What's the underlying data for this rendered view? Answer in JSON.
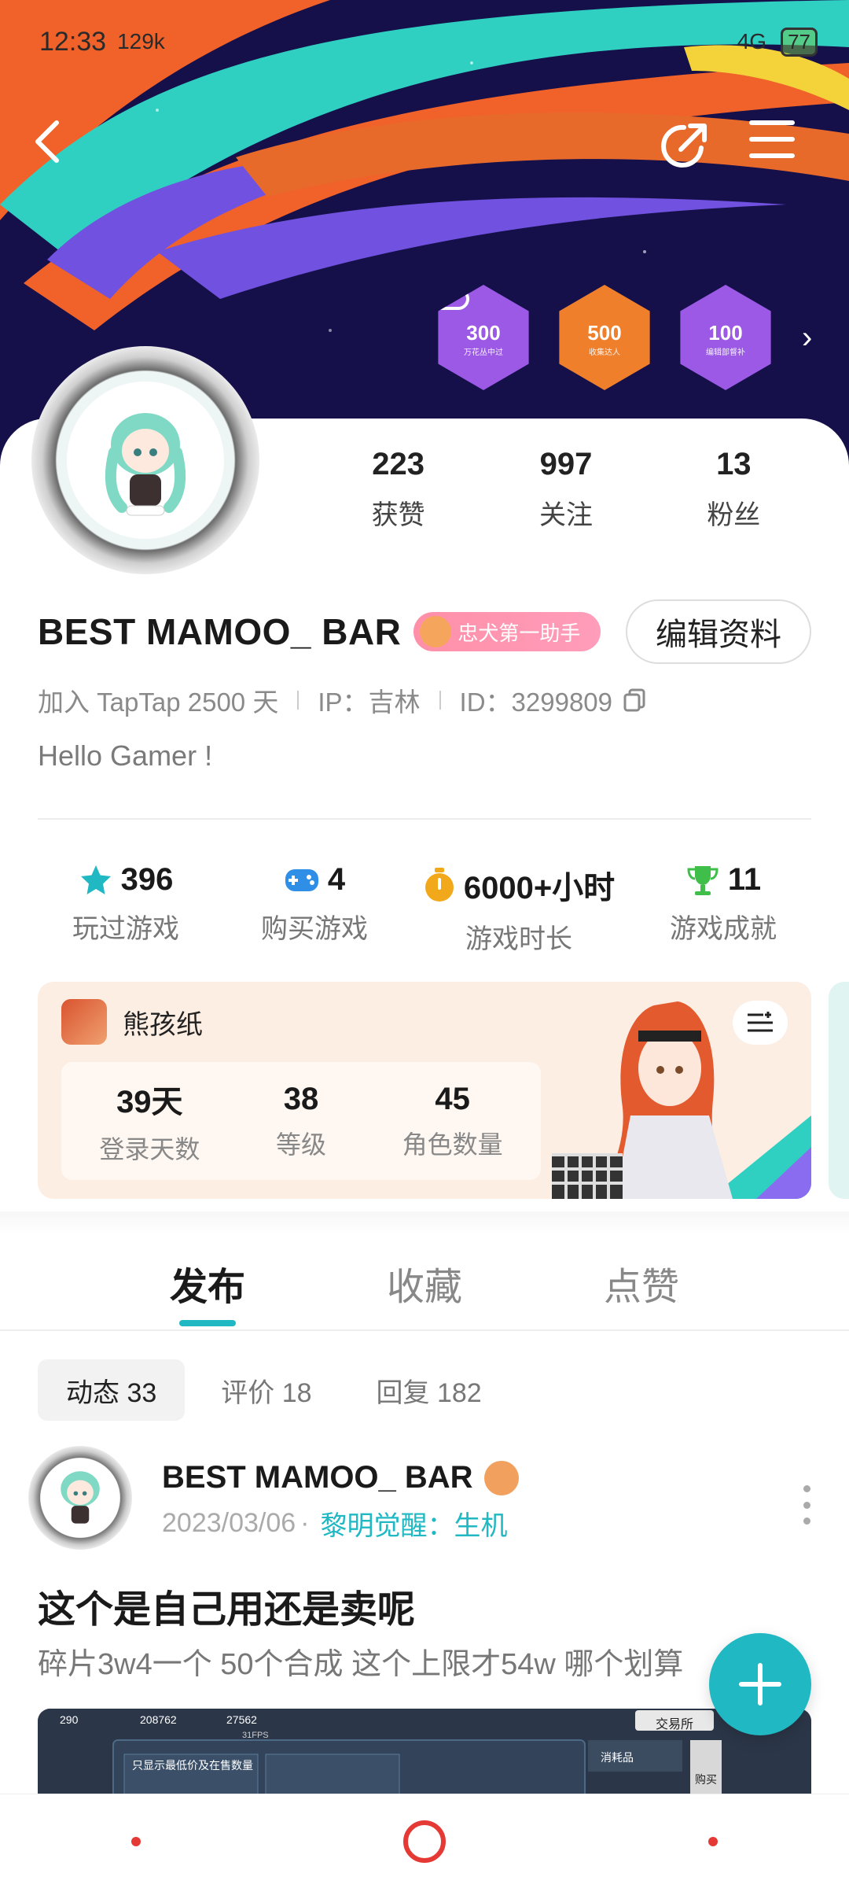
{
  "status_bar": {
    "time": "12:33",
    "speed": "129k",
    "network": "4G",
    "battery": "77"
  },
  "header": {
    "back_icon": "chevron-left-icon",
    "share_icon": "share-icon",
    "menu_icon": "hamburger-menu-icon",
    "badges": [
      {
        "value": "300",
        "caption": "万花丛中过",
        "color": "#9b59e6"
      },
      {
        "value": "500",
        "caption": "收集达人",
        "color": "#f07f2c"
      },
      {
        "value": "100",
        "caption": "编辑部督补",
        "color": "#9b59e6"
      }
    ]
  },
  "profile": {
    "stats": [
      {
        "value": "223",
        "label": "获赞"
      },
      {
        "value": "997",
        "label": "关注"
      },
      {
        "value": "13",
        "label": "粉丝"
      }
    ],
    "name": "BEST MAMOO_ BAR",
    "tag": "忠犬第一助手",
    "edit_label": "编辑资料",
    "joined": "加入 TapTap 2500 天",
    "ip": "IP：吉林",
    "id": "ID：3299809",
    "bio": "Hello Gamer !"
  },
  "game_stats": [
    {
      "value": "396",
      "label": "玩过游戏",
      "icon": "star-icon",
      "color": "#1fb8c3"
    },
    {
      "value": "4",
      "label": "购买游戏",
      "icon": "gamepad-icon",
      "color": "#2f8fe6"
    },
    {
      "value": "6000+小时",
      "label": "游戏时长",
      "icon": "stopwatch-icon",
      "color": "#f2a81b"
    },
    {
      "value": "11",
      "label": "游戏成就",
      "icon": "trophy-icon",
      "color": "#3fbf4a"
    }
  ],
  "game_card": {
    "name": "熊孩纸",
    "stats": [
      {
        "value": "39天",
        "label": "登录天数"
      },
      {
        "value": "38",
        "label": "等级"
      },
      {
        "value": "45",
        "label": "角色数量"
      }
    ]
  },
  "tabs": [
    "发布",
    "收藏",
    "点赞"
  ],
  "subtabs": [
    "动态 33",
    "评价 18",
    "回复 182"
  ],
  "post": {
    "author": "BEST MAMOO_ BAR",
    "date": "2023/03/06",
    "game": "黎明觉醒：生机",
    "title": "这个是自己用还是卖呢",
    "body": "碎片3w4一个 50个合成 这个上限才54w 哪个划算",
    "screenshot_texts": {
      "a": "290",
      "b": "208762",
      "c": "27562",
      "d": "交易所",
      "e": "只显示最低价及在售数量",
      "f": "消耗品",
      "g": "购买",
      "h": "31FPS"
    }
  }
}
